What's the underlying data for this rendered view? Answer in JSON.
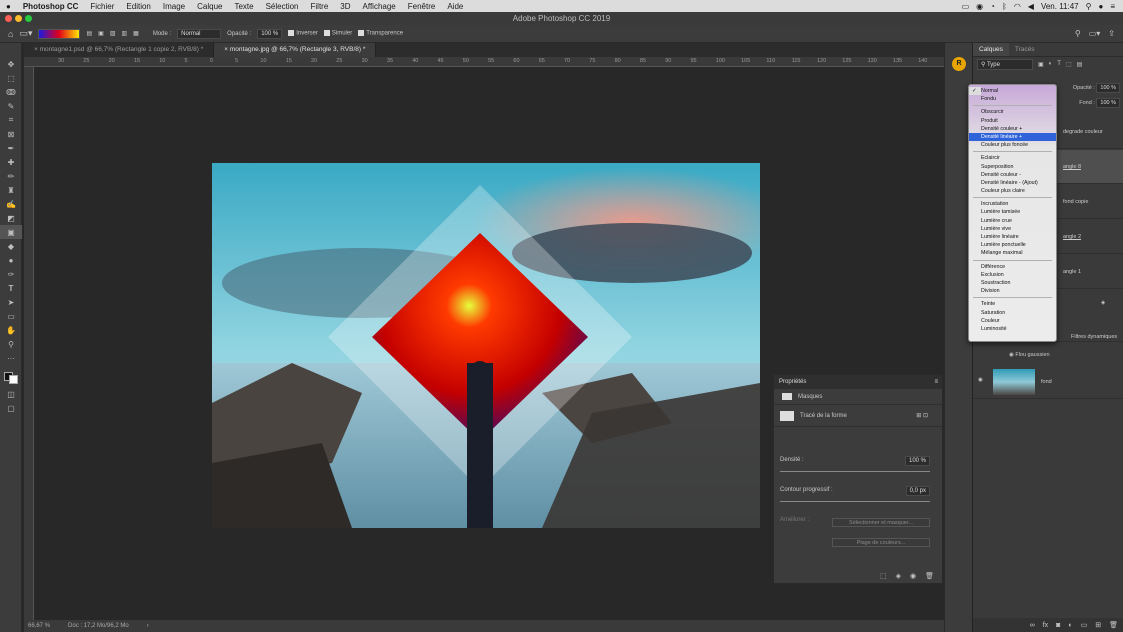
{
  "menubar": {
    "app_name": "Photoshop CC",
    "items": [
      "Fichier",
      "Edition",
      "Image",
      "Calque",
      "Texte",
      "Sélection",
      "Filtre",
      "3D",
      "Affichage",
      "Fenêtre",
      "Aide"
    ],
    "clock": "Ven. 11:47"
  },
  "window_title": "Adobe Photoshop CC 2019",
  "options": {
    "mode_label": "Mode :",
    "mode_value": "Normal",
    "opacity_label": "Opacité :",
    "opacity_value": "100 %",
    "invert": "Inverser",
    "simulate": "Simuler",
    "transparency": "Transparence"
  },
  "tabs": [
    {
      "label": "montagne1.psd @ 66,7% (Rectangle 1 copie 2, RVB/8) *",
      "active": false
    },
    {
      "label": "montagne.jpg @ 66,7% (Rectangle 3, RVB/8) *",
      "active": true
    }
  ],
  "ruler_ticks": [
    "30",
    "25",
    "20",
    "15",
    "10",
    "5",
    "0",
    "5",
    "10",
    "15",
    "20",
    "25",
    "30",
    "35",
    "40",
    "45",
    "50",
    "55",
    "60",
    "65",
    "70",
    "75",
    "80",
    "85",
    "90",
    "95",
    "100",
    "105",
    "110",
    "115",
    "120",
    "125",
    "130",
    "135",
    "140"
  ],
  "status": {
    "zoom": "66,67 %",
    "doc": "Doc : 17,2 Mo/96,2 Mo"
  },
  "layers_panel": {
    "tabs": [
      "Calques",
      "Tracés"
    ],
    "filter": "Type",
    "opacity_label": "Opacité :",
    "opacity_value": "100 %",
    "fill_label": "Fond :",
    "fill_value": "100 %",
    "layer_names": [
      "degrade couleur",
      "angle 8",
      "fond copie",
      "angle 2",
      "angle 1",
      "Filtres dynamiques",
      "Flou gaussien",
      "fond"
    ]
  },
  "blend_menu": {
    "groups": [
      [
        "Normal",
        "Fondu"
      ],
      [
        "Obscurcir",
        "Produit",
        "Densité couleur +",
        "Densité linéaire +",
        "Couleur plus foncée"
      ],
      [
        "Eclaircir",
        "Superposition",
        "Densité couleur -",
        "Densité linéaire - (Ajout)",
        "Couleur plus claire"
      ],
      [
        "Incrustation",
        "Lumière tamisée",
        "Lumière crue",
        "Lumière vive",
        "Lumière linéaire",
        "Lumière ponctuelle",
        "Mélange maximal"
      ],
      [
        "Différence",
        "Exclusion",
        "Soustraction",
        "Division"
      ],
      [
        "Teinte",
        "Saturation",
        "Couleur",
        "Luminosité"
      ]
    ],
    "checked": "Normal",
    "highlighted": "Densité linéaire +"
  },
  "properties": {
    "title": "Propriétés",
    "section": "Masques",
    "shape_mask": "Tracé de la forme",
    "density_label": "Densité :",
    "density_value": "100 %",
    "feather_label": "Contour progressif :",
    "feather_value": "0,0 px",
    "refine_label": "Améliorer :",
    "select_mask": "Sélectionner et masquer...",
    "color_range": "Plage de couleurs..."
  },
  "colors": {
    "accent": "#2e63d9",
    "panel": "#3c3c3c",
    "canvas": "#282828"
  }
}
